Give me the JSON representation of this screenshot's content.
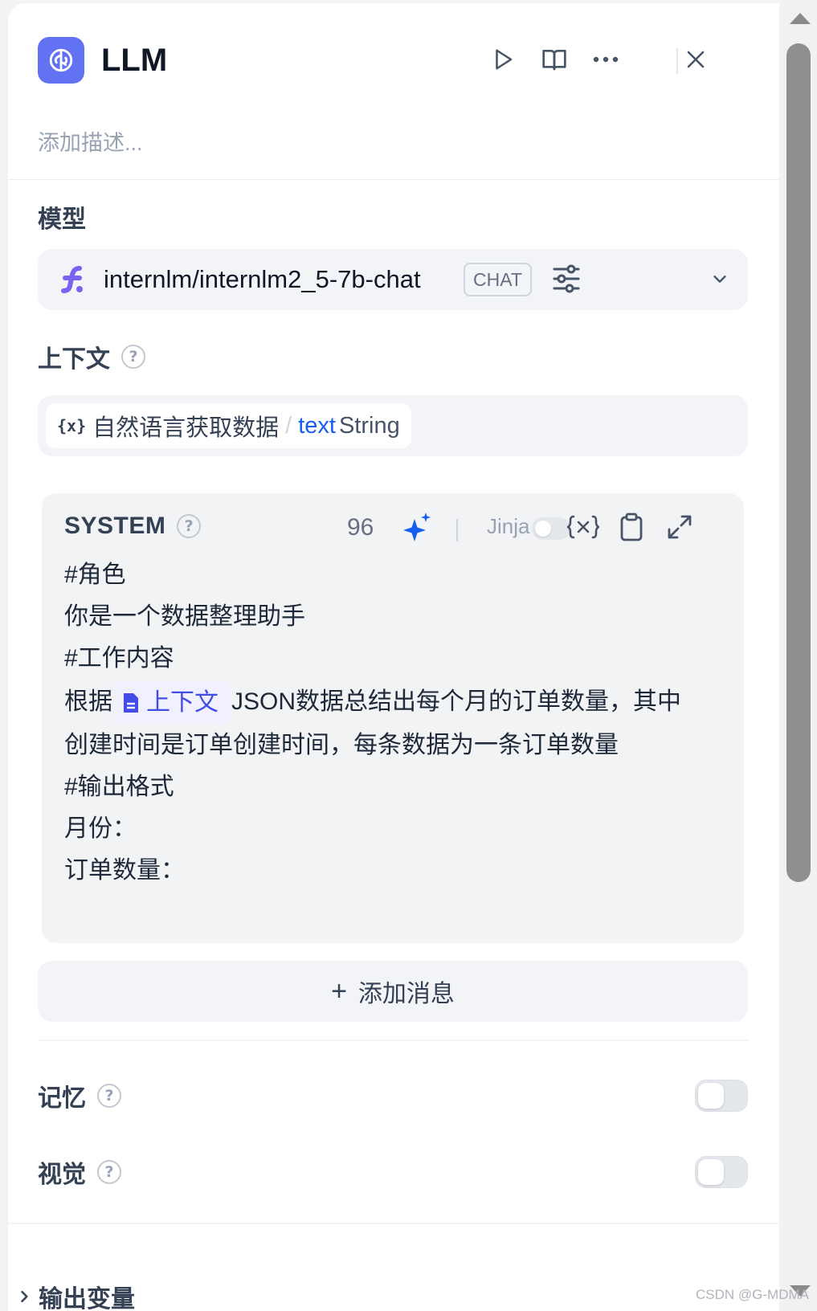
{
  "header": {
    "title": "LLM",
    "description_placeholder": "添加描述...",
    "icons": [
      "brain-icon",
      "play-icon",
      "book-icon",
      "more-icon",
      "close-icon"
    ]
  },
  "model": {
    "label": "模型",
    "name": "internlm/internlm2_5-7b-chat",
    "mode_badge": "CHAT"
  },
  "context": {
    "label": "上下文",
    "var_icon": "{x}",
    "node": "自然语言获取数据",
    "separator": "/",
    "field": "text",
    "type": "String"
  },
  "system": {
    "title": "SYSTEM",
    "token_count": "96",
    "jinja_label": "Jinja",
    "lines": [
      "#角色",
      "你是一个数据整理助手",
      "#工作内容"
    ],
    "line4_prefix": "根据",
    "line4_ref": "上下文",
    "line4_suffix": "JSON数据总结出每个月的订单数量，其中",
    "lines_after": [
      "创建时间是订单创建时间，每条数据为一条订单数量",
      "#输出格式",
      "月份：",
      "订单数量："
    ]
  },
  "add_message": {
    "plus": "+",
    "label": "添加消息"
  },
  "memory": {
    "label": "记忆",
    "enabled": false
  },
  "vision": {
    "label": "视觉",
    "enabled": false
  },
  "output_vars": {
    "label": "输出变量"
  },
  "watermark": "CSDN @G-MDMA",
  "colors": {
    "accent": "#6172f3",
    "link_blue": "#155eef",
    "ref_purple": "#444ce7",
    "panel_bg": "#f2f4f7"
  }
}
